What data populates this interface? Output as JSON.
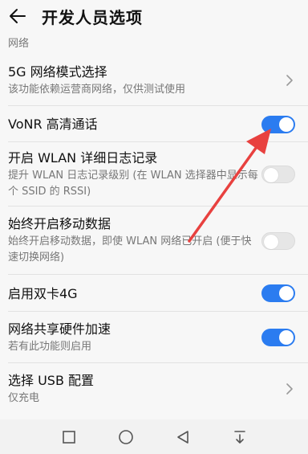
{
  "header": {
    "title": "开发人员选项"
  },
  "section": {
    "label": "网络"
  },
  "rows": [
    {
      "title": "5G 网络模式选择",
      "subtitle": "该功能依赖运营商网络，仅供测试使用"
    },
    {
      "title": "VoNR 高清通话",
      "toggle": "on"
    },
    {
      "title": "开启 WLAN 详细日志记录",
      "subtitle": "提升 WLAN 日志记录级别 (在 WLAN 选择器中显示每个 SSID 的 RSSI)",
      "toggle": "off"
    },
    {
      "title": "始终开启移动数据",
      "subtitle": "始终开启移动数据，即使 WLAN 网络已开启 (便于快速切换网络)",
      "toggle": "off"
    },
    {
      "title": "启用双卡4G",
      "toggle": "on"
    },
    {
      "title": "网络共享硬件加速",
      "subtitle": "若有此功能则启用",
      "toggle": "on"
    },
    {
      "title": "选择 USB 配置",
      "subtitle": "仅充电"
    }
  ],
  "colors": {
    "accent": "#2b7cf0",
    "annotation_arrow": "#e8413f"
  },
  "icons": {
    "back": "arrow-left-icon",
    "nav": [
      "square-recents-icon",
      "circle-home-icon",
      "triangle-back-icon",
      "notification-down-icon"
    ]
  }
}
